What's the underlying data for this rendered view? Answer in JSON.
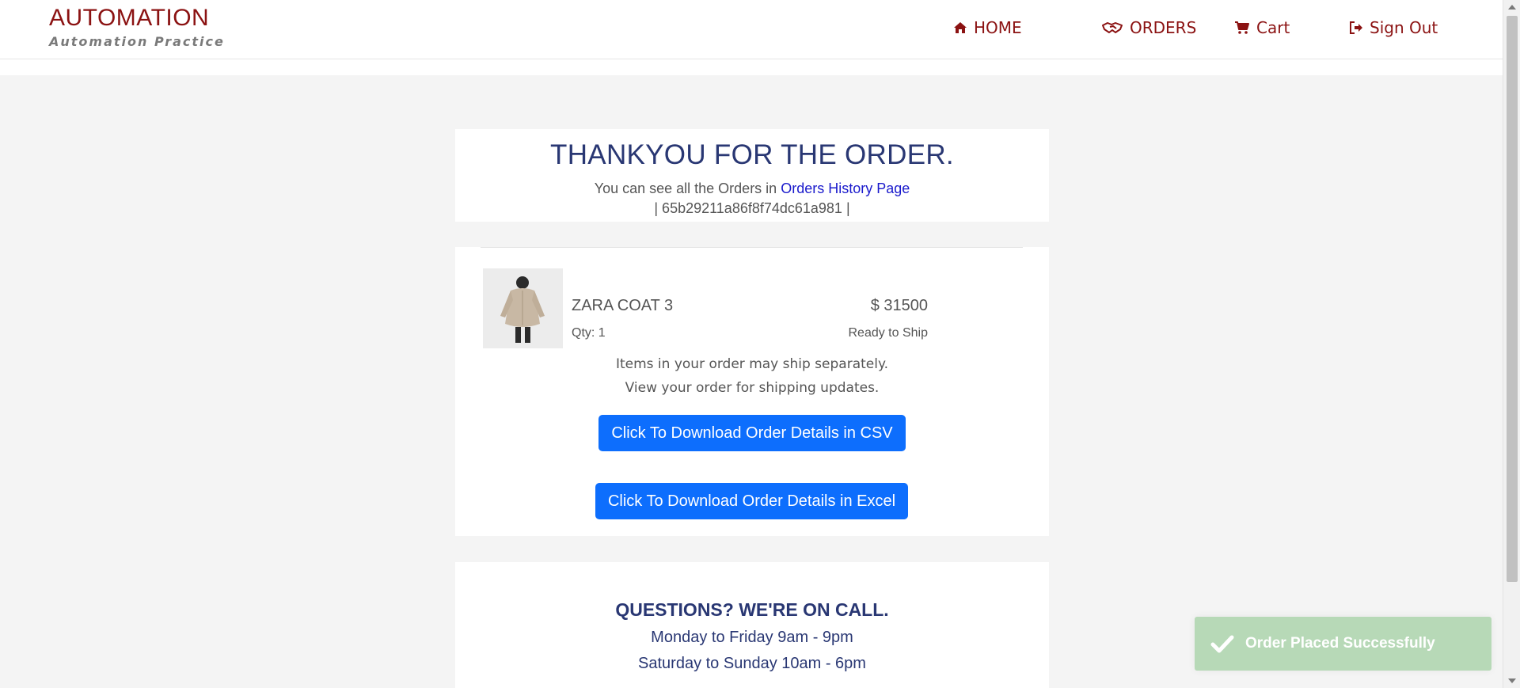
{
  "brand": {
    "title": "AUTOMATION",
    "subtitle": "Automation Practice"
  },
  "nav": {
    "home": "HOME",
    "orders": "ORDERS",
    "cart": "Cart",
    "sign_out": "Sign Out"
  },
  "thanks": {
    "title": "THANKYOU FOR THE ORDER.",
    "line_prefix": "You can see all the Orders in ",
    "history_link": "Orders History Page",
    "order_id": "| 65b29211a86f8f74dc61a981 |"
  },
  "order": {
    "product_name": "ZARA COAT 3",
    "price": "$ 31500",
    "qty": "Qty: 1",
    "status": "Ready to Ship",
    "note_line1": "Items in your order may ship separately.",
    "note_line2": "View your order for shipping updates.",
    "csv_button": "Click To Download Order Details in CSV",
    "excel_button": "Click To Download Order Details in Excel"
  },
  "questions": {
    "title": "QUESTIONS? WE'RE ON CALL.",
    "weekday_hours": "Monday to Friday 9am - 9pm",
    "weekend_hours": "Saturday to Sunday 10am - 6pm"
  },
  "toast": {
    "message": "Order Placed Successfully",
    "icon": "check-icon"
  },
  "colors": {
    "brand": "#8b1212",
    "heading": "#293773",
    "link": "#1a1acc",
    "button": "#0d6efd",
    "toast": "#b7d9b7"
  }
}
